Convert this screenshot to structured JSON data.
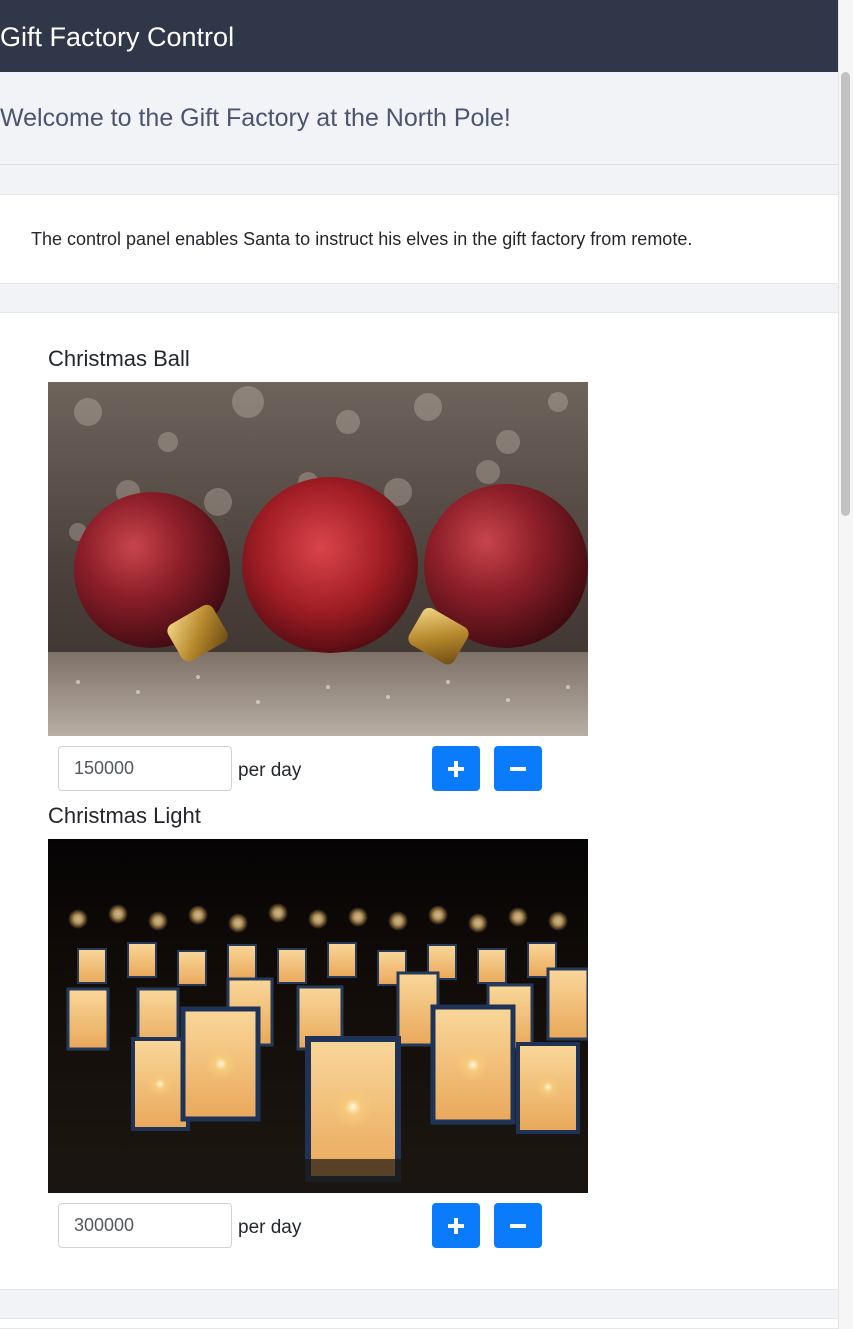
{
  "navbar": {
    "title": "Gift Factory Control"
  },
  "header": {
    "welcome": "Welcome to the Gift Factory at the North Pole!"
  },
  "intro": {
    "text": "The control panel enables Santa to instruct his elves in the gift factory from remote."
  },
  "products": [
    {
      "title": "Christmas Ball",
      "quantity": "150000",
      "unit_label": "per day",
      "image_icon": "christmas-balls-photo",
      "increase_icon": "plus-icon",
      "decrease_icon": "minus-icon"
    },
    {
      "title": "Christmas Light",
      "quantity": "300000",
      "unit_label": "per day",
      "image_icon": "lanterns-photo",
      "increase_icon": "plus-icon",
      "decrease_icon": "minus-icon"
    }
  ],
  "colors": {
    "navbar": "#2f3748",
    "accent_button": "#0a7bfa",
    "page_background": "#f2f3f6"
  }
}
